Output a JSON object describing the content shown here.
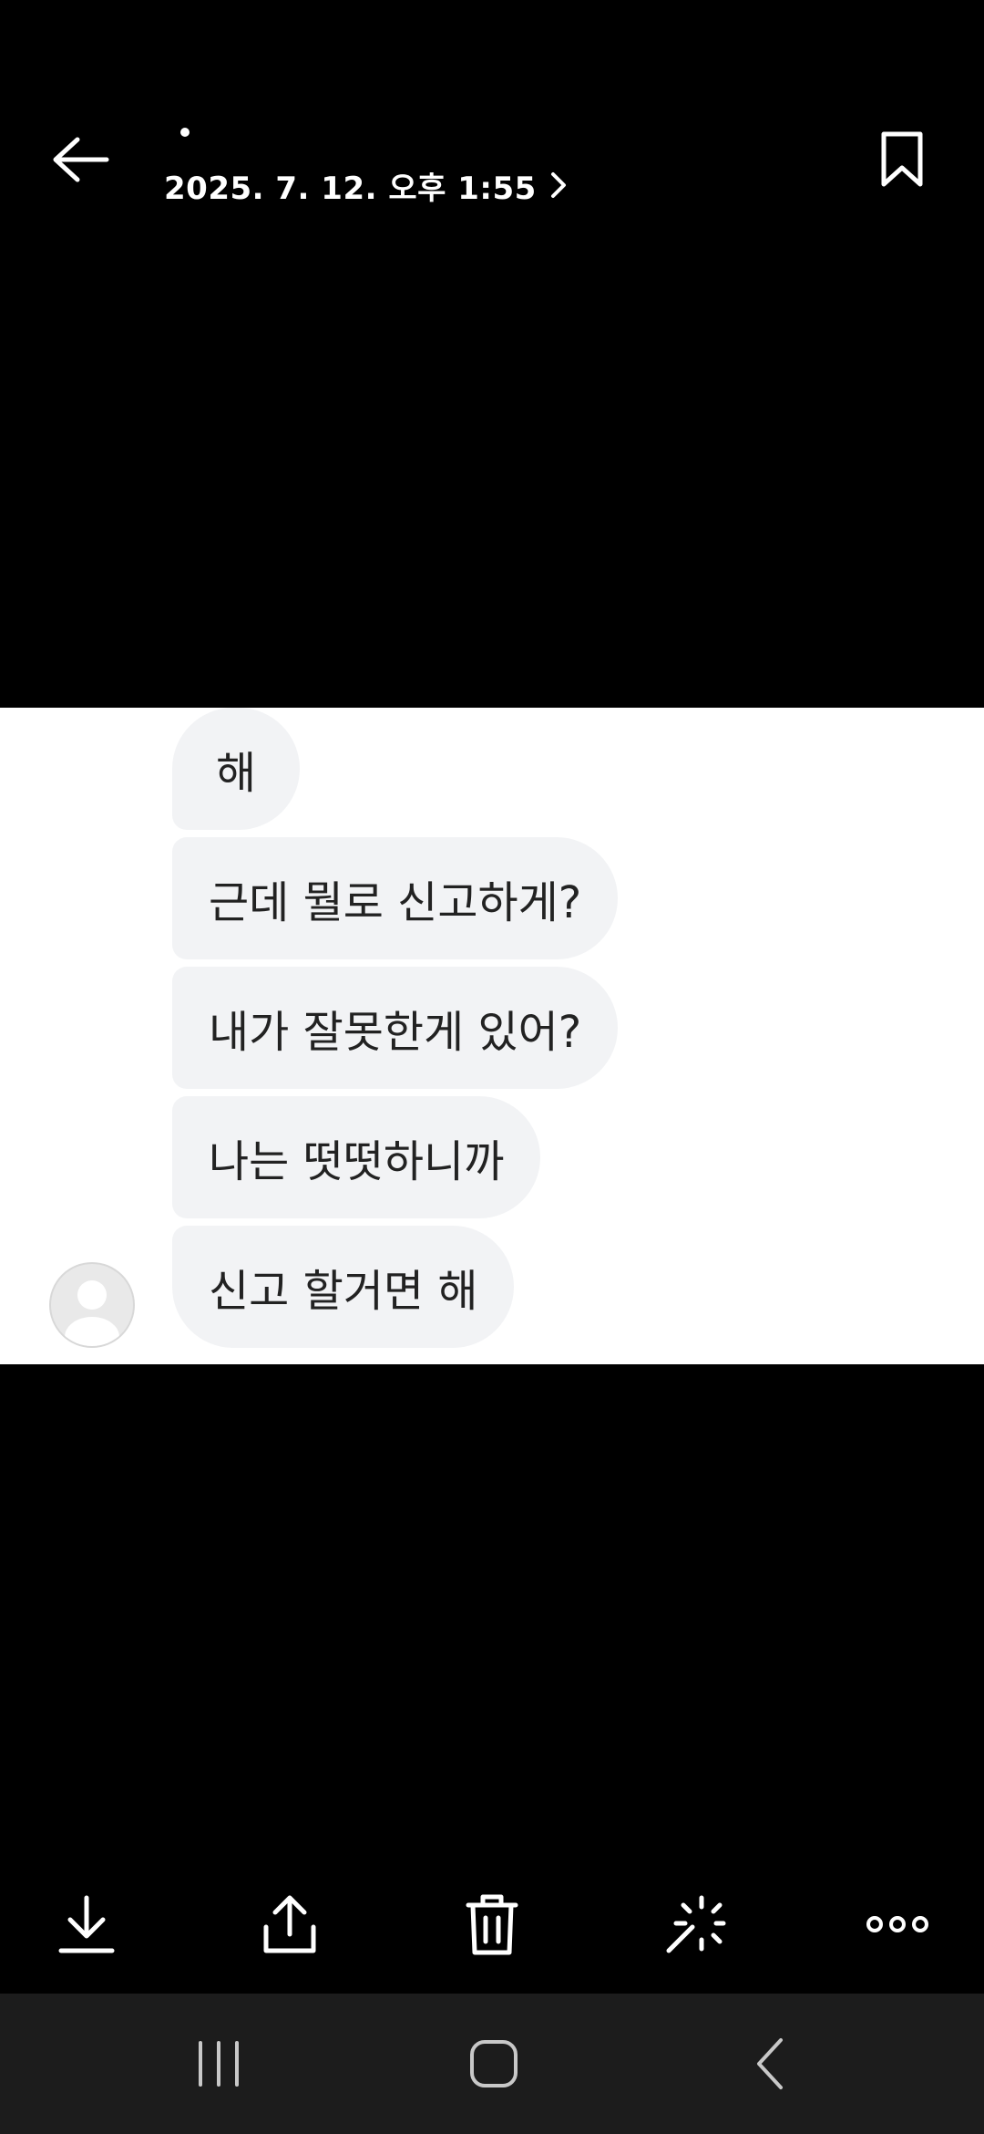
{
  "header": {
    "datetime": "2025. 7. 12. 오후 1:55",
    "back_icon": "arrow-left-icon",
    "bookmark_icon": "bookmark-icon",
    "chevron_icon": "chevron-right-icon"
  },
  "photo": {
    "messages": [
      {
        "text": "해"
      },
      {
        "text": "근데 뭘로 신고하게?"
      },
      {
        "text": "내가 잘못한게 있어?"
      },
      {
        "text": "나는 떳떳하니까"
      },
      {
        "text": "신고 할거면 해"
      }
    ],
    "avatar_icon": "default-avatar-icon",
    "bubble_color": "#f2f3f5",
    "background_color": "#ffffff"
  },
  "actions": [
    {
      "icon": "download-icon"
    },
    {
      "icon": "share-icon"
    },
    {
      "icon": "trash-icon"
    },
    {
      "icon": "magic-wand-icon"
    },
    {
      "icon": "more-options-icon"
    }
  ],
  "navbar": {
    "recents_icon": "recent-apps-icon",
    "home_icon": "home-icon",
    "back_icon": "nav-back-icon"
  },
  "colors": {
    "background": "#000000",
    "navbar": "#1c1c1c",
    "foreground": "#ffffff"
  }
}
